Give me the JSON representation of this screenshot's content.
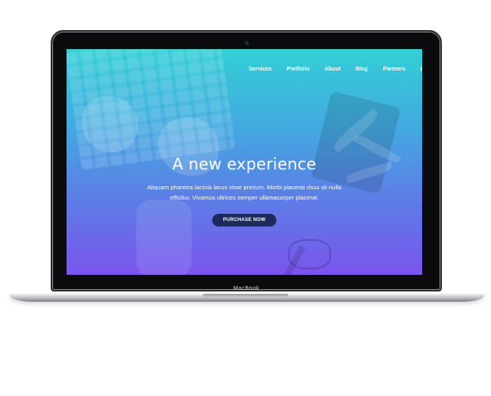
{
  "device": {
    "label": "MacBook"
  },
  "nav": {
    "items": [
      "Services",
      "Portfolio",
      "About",
      "Blog",
      "Partners"
    ]
  },
  "hero": {
    "title": "A new experience",
    "subtitle": "Aliquam pharetra lacinia lacus vitae pretium. Morbi placerat risus sit nulla efficitur. Vivamus ultrices semper ullamacorper placerat.",
    "cta_label": "PURCHASE NOW"
  },
  "colors": {
    "gradient_top": "#33cfd6",
    "gradient_bottom": "#7a55ec",
    "cta_background": "#1e2a5e"
  }
}
